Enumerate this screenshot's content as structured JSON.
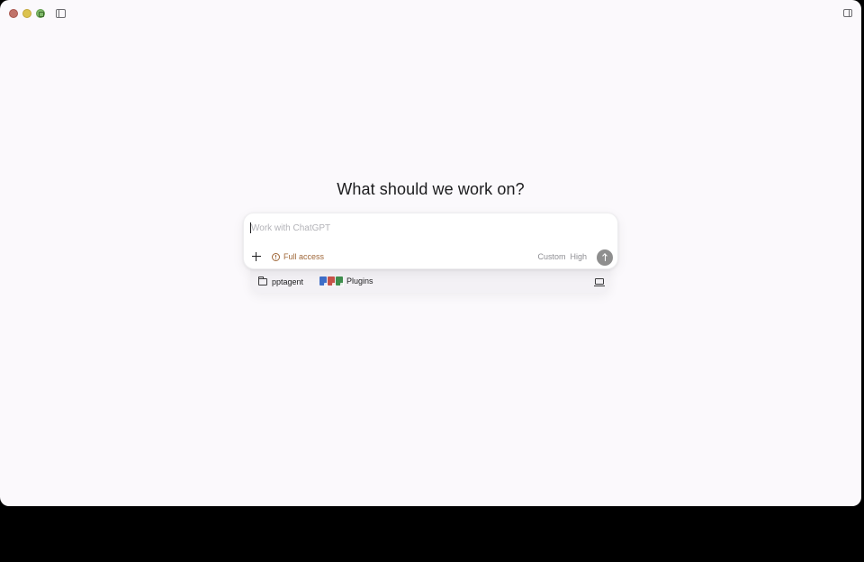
{
  "window": {
    "controls": [
      "close",
      "minimize",
      "zoom"
    ]
  },
  "main": {
    "headline": "What should we work on?"
  },
  "composer": {
    "input_placeholder": "Work with ChatGPT",
    "input_value": "",
    "access_label": "Full access",
    "model_label": "Custom",
    "reasoning_label": "High",
    "access_color": "#a0683a"
  },
  "context": {
    "folder_label": "pptagent",
    "plugins_label": "Plugins",
    "plugin_icon_colors": [
      "#3f6fc9",
      "#c8534a",
      "#3f8f4e"
    ]
  },
  "icons": {
    "sidebar_toggle": "sidebar-icon",
    "panel_toggle": "panel-right-icon",
    "add": "plus-icon",
    "access": "warning-circle-icon",
    "send": "arrow-up-icon",
    "folder": "folder-icon",
    "environment": "laptop-icon"
  }
}
